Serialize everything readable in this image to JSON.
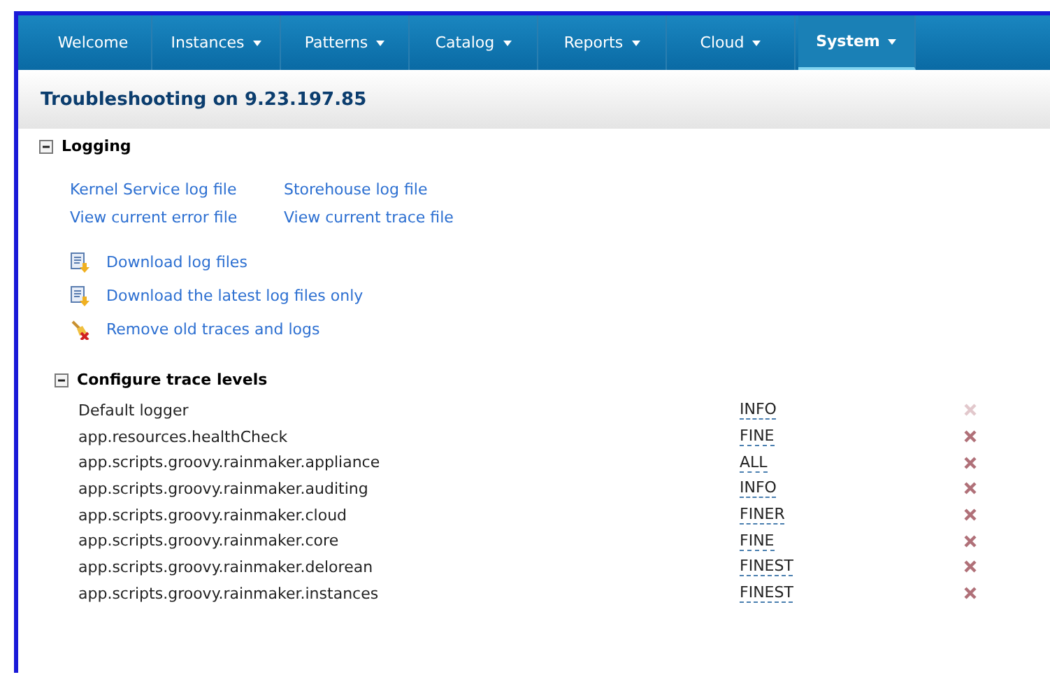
{
  "nav": {
    "tabs": [
      {
        "label": "Welcome",
        "dropdown": false,
        "selected": false
      },
      {
        "label": "Instances",
        "dropdown": true,
        "selected": false
      },
      {
        "label": "Patterns",
        "dropdown": true,
        "selected": false
      },
      {
        "label": "Catalog",
        "dropdown": true,
        "selected": false
      },
      {
        "label": "Reports",
        "dropdown": true,
        "selected": false
      },
      {
        "label": "Cloud",
        "dropdown": true,
        "selected": false
      },
      {
        "label": "System",
        "dropdown": true,
        "selected": true
      }
    ]
  },
  "page_title": "Troubleshooting on 9.23.197.85",
  "logging": {
    "title": "Logging",
    "expanded": true,
    "links": [
      [
        "Kernel Service log file",
        "Storehouse log file"
      ],
      [
        "View current error file",
        "View current trace file"
      ]
    ],
    "actions": [
      {
        "label": "Download log files",
        "kind": "download"
      },
      {
        "label": "Download the latest log files only",
        "kind": "download"
      },
      {
        "label": "Remove old traces and logs",
        "kind": "remove"
      }
    ],
    "trace": {
      "title": "Configure trace levels",
      "expanded": true,
      "rows": [
        {
          "logger": "Default logger",
          "level": "INFO",
          "disabled": true
        },
        {
          "logger": "app.resources.healthCheck",
          "level": "FINE",
          "disabled": false
        },
        {
          "logger": "app.scripts.groovy.rainmaker.appliance",
          "level": "ALL",
          "disabled": false
        },
        {
          "logger": "app.scripts.groovy.rainmaker.auditing",
          "level": "INFO",
          "disabled": false
        },
        {
          "logger": "app.scripts.groovy.rainmaker.cloud",
          "level": "FINER",
          "disabled": false
        },
        {
          "logger": "app.scripts.groovy.rainmaker.core",
          "level": "FINE",
          "disabled": false
        },
        {
          "logger": "app.scripts.groovy.rainmaker.delorean",
          "level": "FINEST",
          "disabled": false
        },
        {
          "logger": "app.scripts.groovy.rainmaker.instances",
          "level": "FINEST",
          "disabled": false
        }
      ]
    }
  }
}
